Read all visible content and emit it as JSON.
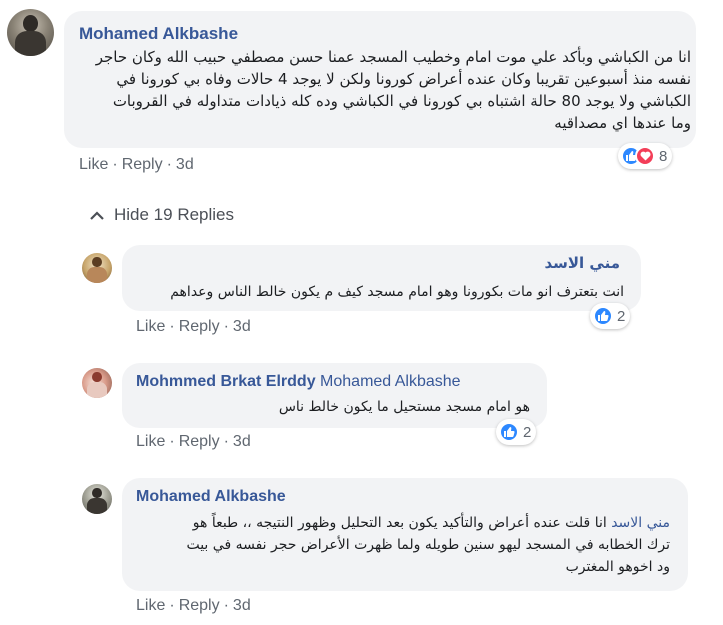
{
  "comments": [
    {
      "author": "Mohamed Alkbashe",
      "mention": "",
      "lines": [
        "انا من الكباشي وبأكد علي موت امام وخطيب المسجد عمنا حسن مصطفي حبيب الله وكان حاجر",
        "نفسه منذ أسبوعين تقريبا وكان عنده أعراض كورونا ولكن لا يوجد 4 حالات وفاه بي كورونا في",
        "الكباشي ولا يوجد 80 حالة اشتباه بي كورونا في الكباشي وده كله ذيادات متداوله في القروبات",
        "وما عندها اي مصداقيه"
      ],
      "like": "Like",
      "reply": "Reply",
      "time": "3d",
      "reaction_count": "8"
    }
  ],
  "hide_replies": "Hide 19 Replies",
  "replies": [
    {
      "author": "مني الاسد",
      "mention": "",
      "lines": [
        "انت بتعترف انو مات بكورونا وهو امام مسجد كيف م يكون خالط الناس وعداهم"
      ],
      "like": "Like",
      "reply": "Reply",
      "time": "3d",
      "reaction_count": "2"
    },
    {
      "author": "Mohmmed Brkat Elrddy",
      "mention": "Mohamed Alkbashe",
      "lines": [
        "هو امام مسجد مستحيل ما يكون خالط ناس"
      ],
      "like": "Like",
      "reply": "Reply",
      "time": "3d",
      "reaction_count": "2"
    },
    {
      "author": "Mohamed Alkbashe",
      "mention": "مني الاسد",
      "lines": [
        "انا قلت عنده أعراض والتأكيد يكون بعد التحليل وظهور النتيجه ،، طبعاً هو",
        "ترك الخطابه في المسجد ليهو سنين طويله ولما ظهرت الأعراض حجر نفسه في بيت",
        "ود اخوهو المغترب"
      ],
      "like": "Like",
      "reply": "Reply",
      "time": "3d",
      "reaction_count": ""
    }
  ],
  "colors": {
    "name": "#385898",
    "bubble": "#f2f3f5",
    "meta": "#606770",
    "like_icon": "#2d88ff",
    "love_icon": "#f33e58"
  }
}
